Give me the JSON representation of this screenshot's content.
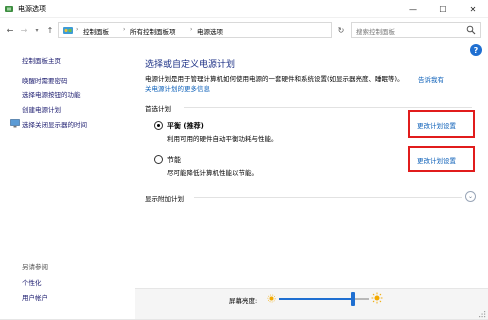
{
  "window": {
    "title": "电源选项",
    "minimize_glyph": "—",
    "maximize_glyph": "☐",
    "close_glyph": "✕"
  },
  "address": {
    "crumbs": [
      "控制面板",
      "所有控制面板项",
      "电源选项"
    ],
    "separator": "›",
    "search_placeholder": "搜索控制面板"
  },
  "help_glyph": "?",
  "sidebar": {
    "home": "控制面板主页",
    "items": [
      "唤醒时需要密码",
      "选择电源按钮的功能",
      "创建电源计划",
      "选择关闭显示器的时间"
    ],
    "see_also_label": "另请参阅",
    "see_also": [
      "个性化",
      "用户帐户"
    ]
  },
  "main": {
    "title": "选择或自定义电源计划",
    "description_line1": "电源计划是用于管理计算机如何使用电源的一套硬件和系统设置(如显示器亮度、睡眠等)。",
    "description_link_a": "告诉我有",
    "description_link_b": "关电源计划的更多信息",
    "preferred_label": "首选计划",
    "plans": [
      {
        "name": "平衡 (推荐)",
        "desc": "利用可用的硬件自动平衡功耗与性能。",
        "selected": true,
        "change": "更改计划设置"
      },
      {
        "name": "节能",
        "desc": "尽可能降低计算机性能以节能。",
        "selected": false,
        "change": "更改计划设置"
      }
    ],
    "more_label": "显示附加计划",
    "expand_glyph": "⌄"
  },
  "brightness": {
    "label": "屏幕亮度:",
    "level_fraction": 0.82
  },
  "colors": {
    "accent": "#1f6fd1",
    "link": "#0b5fb8",
    "highlight": "#e11c1c",
    "heading": "#1e3287"
  }
}
